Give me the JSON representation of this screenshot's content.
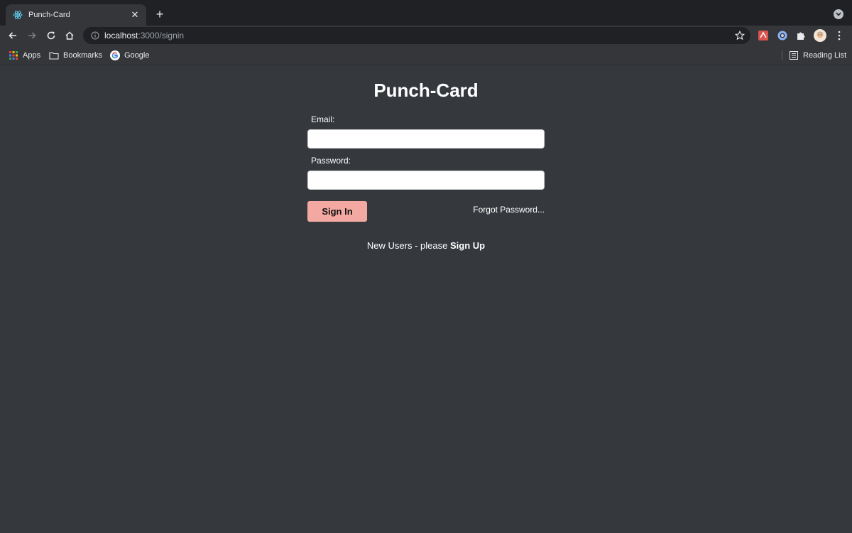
{
  "browser": {
    "tab": {
      "title": "Punch-Card"
    },
    "address": {
      "host": "localhost",
      "path": ":3000/signin"
    },
    "bookmarks": {
      "items": [
        {
          "label": "Apps"
        },
        {
          "label": "Bookmarks"
        },
        {
          "label": "Google"
        }
      ],
      "reading_list": "Reading List"
    }
  },
  "signin": {
    "title": "Punch-Card",
    "email_label": "Email:",
    "email_value": "",
    "password_label": "Password:",
    "password_value": "",
    "sign_in_label": "Sign In",
    "forgot_label": "Forgot Password...",
    "new_users_text": "New Users - please ",
    "sign_up_label": "Sign Up"
  },
  "colors": {
    "page_bg": "#35383d",
    "sign_in_button": "#f3a9a1",
    "chrome_frame": "#202124",
    "chrome_toolbar": "#35363a"
  },
  "icons": [
    "react-favicon-icon",
    "close-icon",
    "plus-icon",
    "tab-search-icon",
    "back-arrow-icon",
    "forward-arrow-icon",
    "reload-icon",
    "home-icon",
    "info-icon",
    "star-icon",
    "extension-red-icon",
    "extension-blue-icon",
    "puzzle-icon",
    "profile-avatar-icon",
    "kebab-menu-icon",
    "apps-grid-icon",
    "folder-icon",
    "google-icon",
    "reading-list-icon"
  ]
}
